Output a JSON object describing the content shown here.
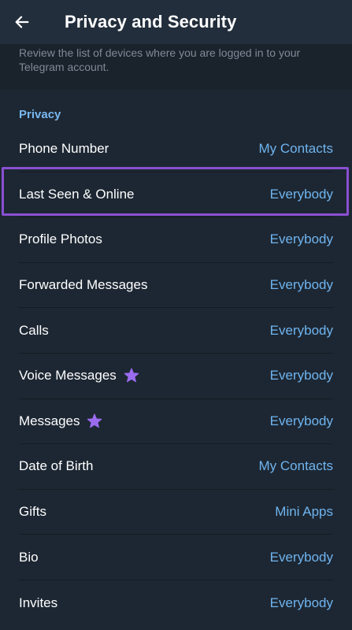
{
  "header": {
    "title": "Privacy and Security",
    "back_icon": "arrow-left-icon"
  },
  "info": {
    "text": "Review the list of devices where you are logged in to your Telegram account."
  },
  "privacy": {
    "section_title": "Privacy",
    "items": [
      {
        "label": "Phone Number",
        "value": "My Contacts",
        "star": false
      },
      {
        "label": "Last Seen & Online",
        "value": "Everybody",
        "star": false
      },
      {
        "label": "Profile Photos",
        "value": "Everybody",
        "star": false
      },
      {
        "label": "Forwarded Messages",
        "value": "Everybody",
        "star": false
      },
      {
        "label": "Calls",
        "value": "Everybody",
        "star": false
      },
      {
        "label": "Voice Messages",
        "value": "Everybody",
        "star": true
      },
      {
        "label": "Messages",
        "value": "Everybody",
        "star": true
      },
      {
        "label": "Date of Birth",
        "value": "My Contacts",
        "star": false
      },
      {
        "label": "Gifts",
        "value": "Mini Apps",
        "star": false
      },
      {
        "label": "Bio",
        "value": "Everybody",
        "star": false
      },
      {
        "label": "Invites",
        "value": "Everybody",
        "star": false
      }
    ]
  },
  "colors": {
    "accent": "#6fb4ef",
    "section_title": "#79b8f0",
    "highlight": "#8a4fd2",
    "premium_star": "#9b6bf0"
  }
}
